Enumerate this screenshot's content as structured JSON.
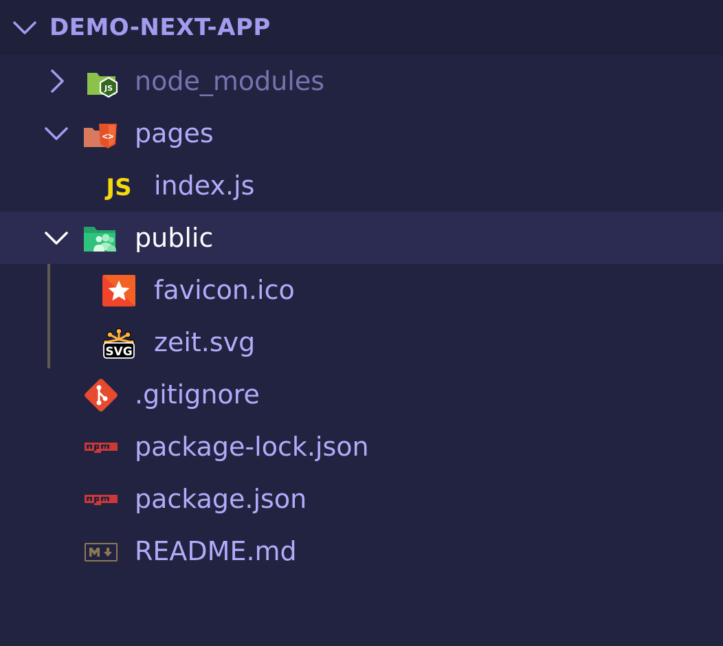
{
  "explorer": {
    "project_title": "DEMO-NEXT-APP",
    "items": [
      {
        "label": "node_modules",
        "type": "folder",
        "expanded": false,
        "icon": "nodejs-folder-icon"
      },
      {
        "label": "pages",
        "type": "folder",
        "expanded": true,
        "icon": "html-folder-icon"
      },
      {
        "label": "index.js",
        "type": "file",
        "icon": "javascript-file-icon"
      },
      {
        "label": "public",
        "type": "folder",
        "expanded": true,
        "selected": true,
        "icon": "public-folder-icon"
      },
      {
        "label": "favicon.ico",
        "type": "file",
        "icon": "favicon-star-icon"
      },
      {
        "label": "zeit.svg",
        "type": "file",
        "icon": "svg-file-icon"
      },
      {
        "label": ".gitignore",
        "type": "file",
        "icon": "git-icon"
      },
      {
        "label": "package-lock.json",
        "type": "file",
        "icon": "npm-icon"
      },
      {
        "label": "package.json",
        "type": "file",
        "icon": "npm-icon"
      },
      {
        "label": "README.md",
        "type": "file",
        "icon": "markdown-icon"
      }
    ]
  },
  "colors": {
    "background": "#222341",
    "header_background": "#1f2039",
    "selected_row": "#2c2c52",
    "label": "#b1acfa",
    "title": "#a29cf0",
    "dim_label": "#7873b0"
  }
}
